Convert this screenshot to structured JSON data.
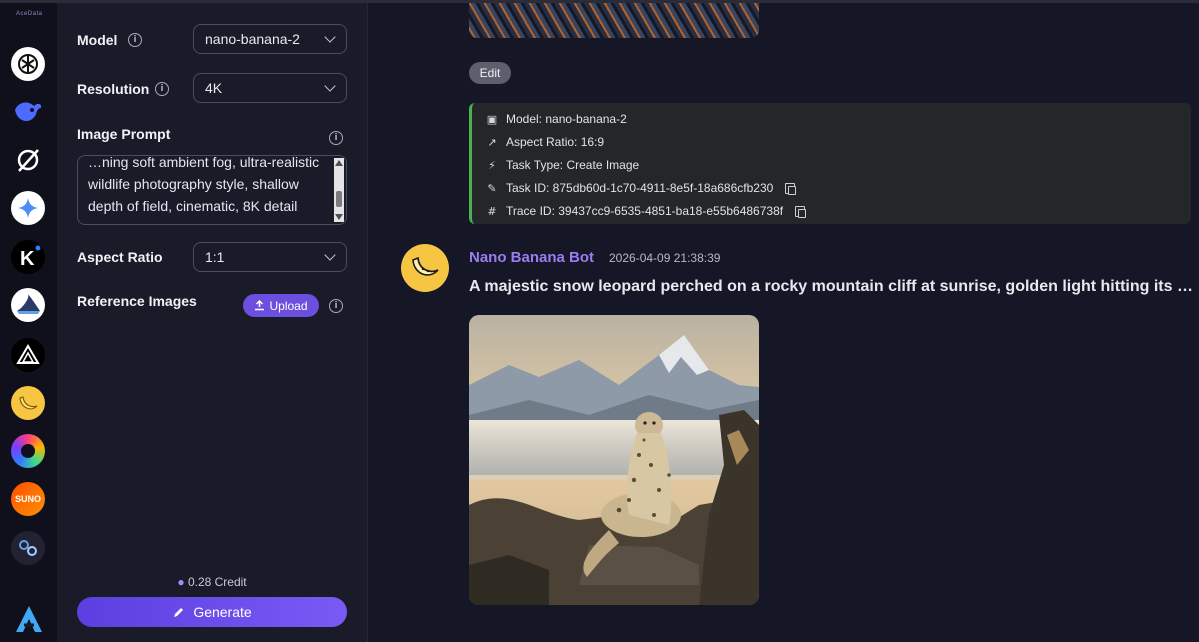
{
  "rail": {
    "logo": "AceData",
    "icons": [
      {
        "name": "chatgpt-icon",
        "color": "#ffffff"
      },
      {
        "name": "deepseek-icon",
        "color": "#4d6bfe"
      },
      {
        "name": "grok-icon",
        "color": "#ffffff"
      },
      {
        "name": "gemini-icon",
        "color": "#ffffff"
      },
      {
        "name": "kling-icon",
        "color": "#000000"
      },
      {
        "name": "shark-icon",
        "color": "#ffffff"
      },
      {
        "name": "triangle-logo-icon",
        "color": "#000000"
      },
      {
        "name": "nano-banana-icon",
        "color": "#f6c642"
      },
      {
        "name": "swirl-icon",
        "color": "#7b3cff"
      },
      {
        "name": "suno-icon",
        "color": "#ff6a00"
      },
      {
        "name": "midjourney-icon",
        "color": "#222233"
      }
    ]
  },
  "panel": {
    "model_label": "Model",
    "model_value": "nano-banana-2",
    "resolution_label": "Resolution",
    "resolution_value": "4K",
    "prompt_label": "Image Prompt",
    "prompt_text": "…ning soft ambient fog, ultra-realistic wildlife photography style, shallow depth of field, cinematic, 8K detail",
    "aspect_label": "Aspect Ratio",
    "aspect_value": "1:1",
    "reference_label": "Reference Images",
    "upload_label": "Upload",
    "credit": "0.28 Credit",
    "generate_label": "Generate"
  },
  "main": {
    "edit_label": "Edit",
    "info": {
      "model": "Model: nano-banana-2",
      "aspect": "Aspect Ratio: 16:9",
      "task_type": "Task Type: Create Image",
      "task_id": "Task ID: 875db60d-1c70-4911-8e5f-18a686cfb230",
      "trace_id": "Trace ID: 39437cc9-6535-4851-ba18-e55b6486738f"
    },
    "bot_name": "Nano Banana Bot",
    "timestamp": "2026-04-09 21:38:39",
    "prompt_title": "A majestic snow leopard perched on a rocky mountain cliff at sunrise, golden light hitting its sp..."
  },
  "colors": {
    "accent": "#6d4fe0",
    "bot_name": "#9b7cf4",
    "info_border": "#4caf50"
  }
}
